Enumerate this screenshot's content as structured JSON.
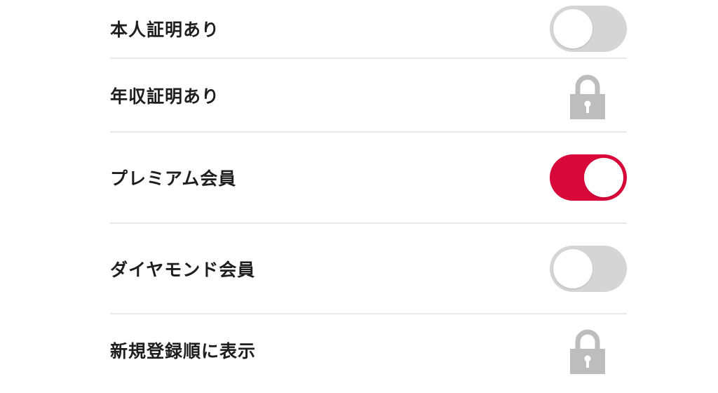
{
  "settings": {
    "items": [
      {
        "label": "本人証明あり",
        "control": "toggle",
        "state": "off"
      },
      {
        "label": "年収証明あり",
        "control": "lock"
      },
      {
        "label": "プレミアム会員",
        "control": "toggle",
        "state": "on"
      },
      {
        "label": "ダイヤモンド会員",
        "control": "toggle",
        "state": "off"
      },
      {
        "label": "新規登録順に表示",
        "control": "lock"
      }
    ]
  },
  "colors": {
    "toggle_on": "#d8083a",
    "toggle_off": "#d5d5d5",
    "lock": "#bdbdbd"
  },
  "icons": {
    "lock": "padlock-icon"
  }
}
